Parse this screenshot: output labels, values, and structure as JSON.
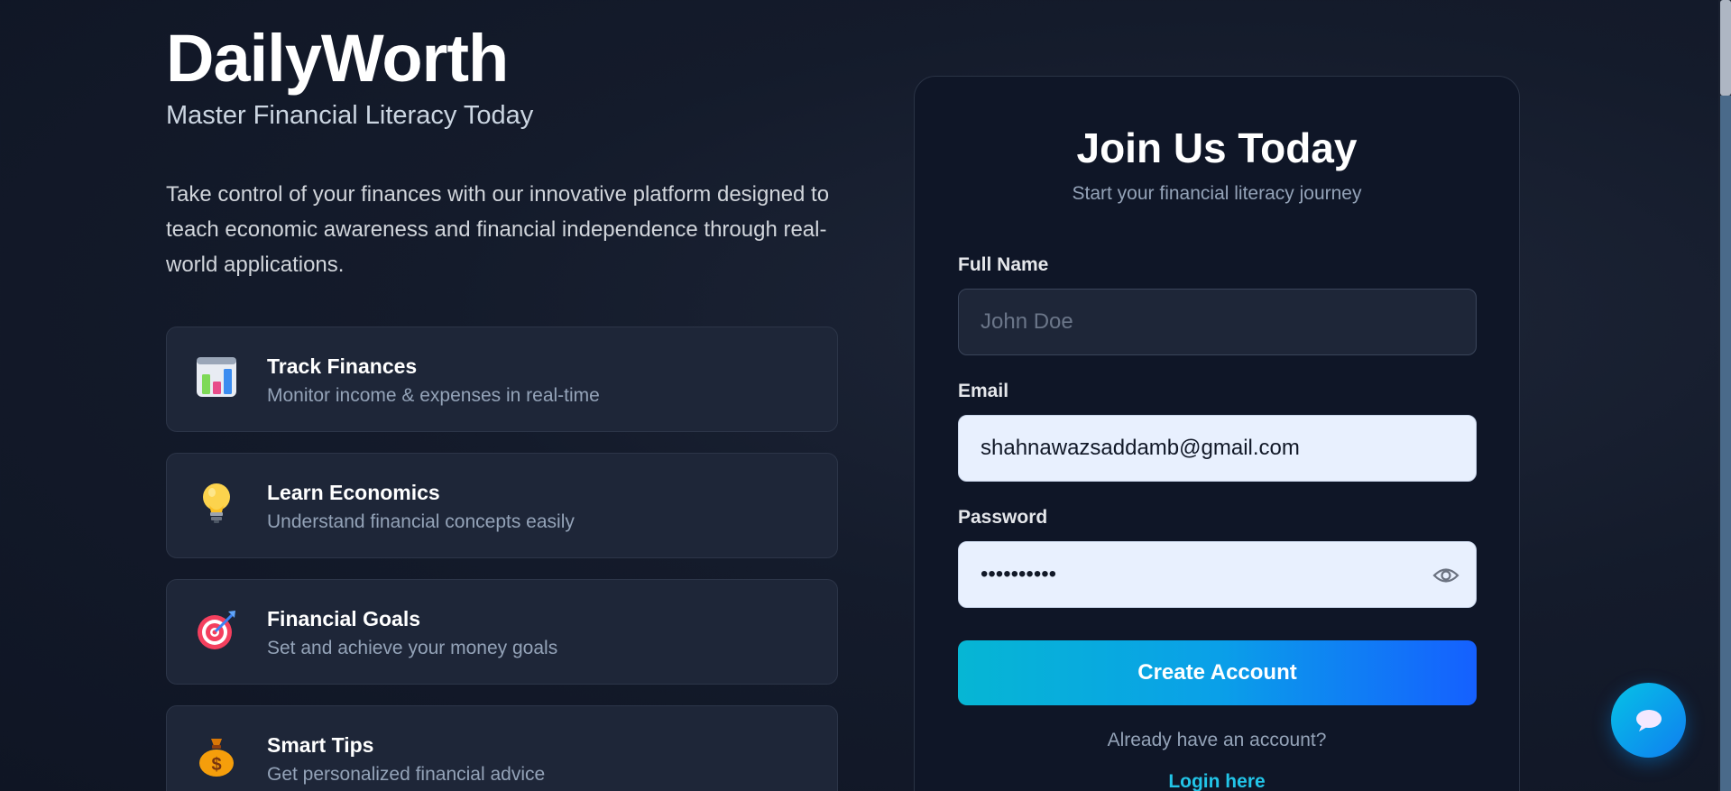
{
  "brand": {
    "title": "DailyWorth",
    "subtitle": "Master Financial Literacy Today"
  },
  "intro": "Take control of your finances with our innovative platform designed to teach economic awareness and financial independence through real-world applications.",
  "features": [
    {
      "icon": "bar-chart-icon",
      "title": "Track Finances",
      "description": "Monitor income & expenses in real-time"
    },
    {
      "icon": "lightbulb-icon",
      "title": "Learn Economics",
      "description": "Understand financial concepts easily"
    },
    {
      "icon": "target-icon",
      "title": "Financial Goals",
      "description": "Set and achieve your money goals"
    },
    {
      "icon": "money-bag-icon",
      "title": "Smart Tips",
      "description": "Get personalized financial advice"
    }
  ],
  "signup": {
    "title": "Join Us Today",
    "subtitle": "Start your financial literacy journey",
    "name_label": "Full Name",
    "name_placeholder": "John Doe",
    "name_value": "",
    "email_label": "Email",
    "email_value": "shahnawazsaddamb@gmail.com",
    "password_label": "Password",
    "password_value": "abcdefghij",
    "submit_label": "Create Account",
    "have_account_text": "Already have an account?",
    "login_link": "Login here"
  },
  "colors": {
    "accent_start": "#06b6d4",
    "accent_end": "#1560ff",
    "link": "#22c5e8",
    "background": "#141b2b"
  }
}
